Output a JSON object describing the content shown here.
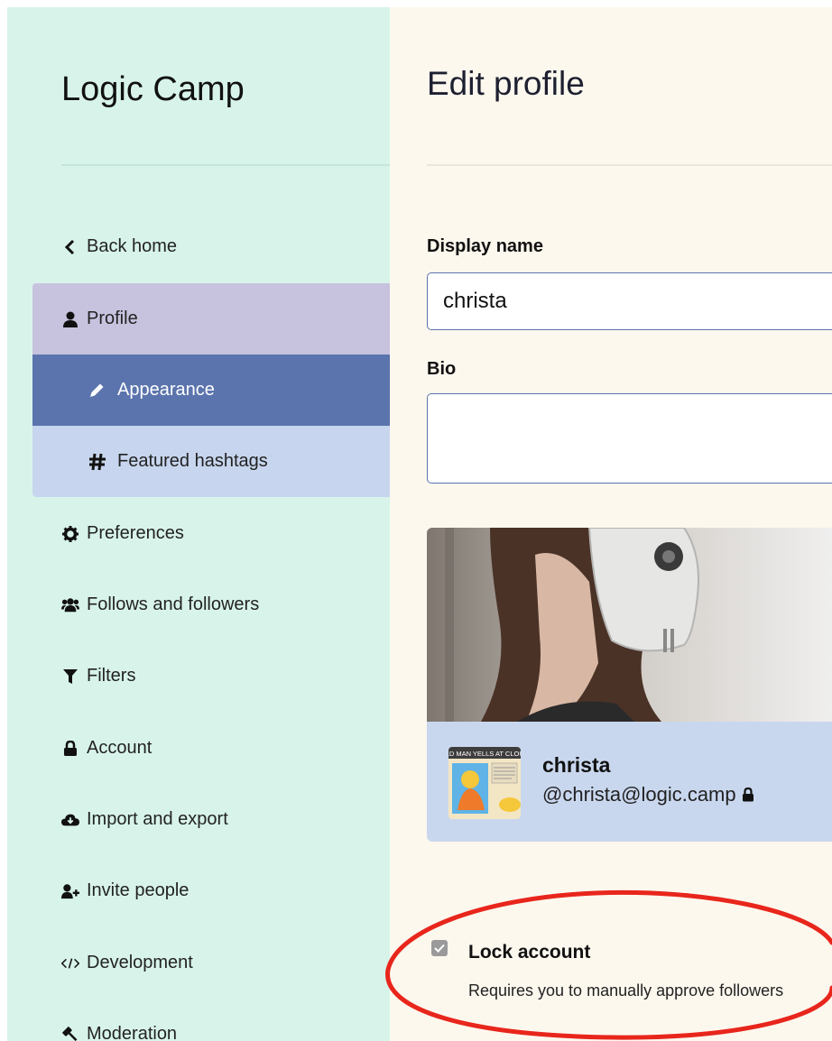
{
  "sidebar": {
    "brand": "Logic Camp",
    "items": [
      {
        "label": "Back home",
        "icon": "chevron-left-icon"
      },
      {
        "label": "Profile",
        "icon": "user-icon"
      },
      {
        "label": "Appearance",
        "icon": "pencil-icon"
      },
      {
        "label": "Featured hashtags",
        "icon": "hashtag-icon"
      },
      {
        "label": "Preferences",
        "icon": "gear-icon"
      },
      {
        "label": "Follows and followers",
        "icon": "users-icon"
      },
      {
        "label": "Filters",
        "icon": "filter-icon"
      },
      {
        "label": "Account",
        "icon": "lock-icon"
      },
      {
        "label": "Import and export",
        "icon": "cloud-download-icon"
      },
      {
        "label": "Invite people",
        "icon": "user-plus-icon"
      },
      {
        "label": "Development",
        "icon": "code-icon"
      },
      {
        "label": "Moderation",
        "icon": "gavel-icon"
      }
    ]
  },
  "main": {
    "title": "Edit profile",
    "display_name": {
      "label": "Display name",
      "value": "christa"
    },
    "bio": {
      "label": "Bio",
      "value": ""
    },
    "preview": {
      "name": "christa",
      "handle": "@christa@logic.camp",
      "avatar_text": "OLD MAN YELLS AT CLOUD"
    },
    "lock_account": {
      "label": "Lock account",
      "hint": "Requires you to manually approve followers",
      "checked": true
    }
  },
  "colors": {
    "sidebar_bg": "#d8f4ea",
    "main_bg": "#fdf8ee",
    "active_item": "#5b74ad",
    "profile_item": "#c7c3de",
    "sub_item": "#c7d6ee",
    "annotation": "#e8261c"
  }
}
